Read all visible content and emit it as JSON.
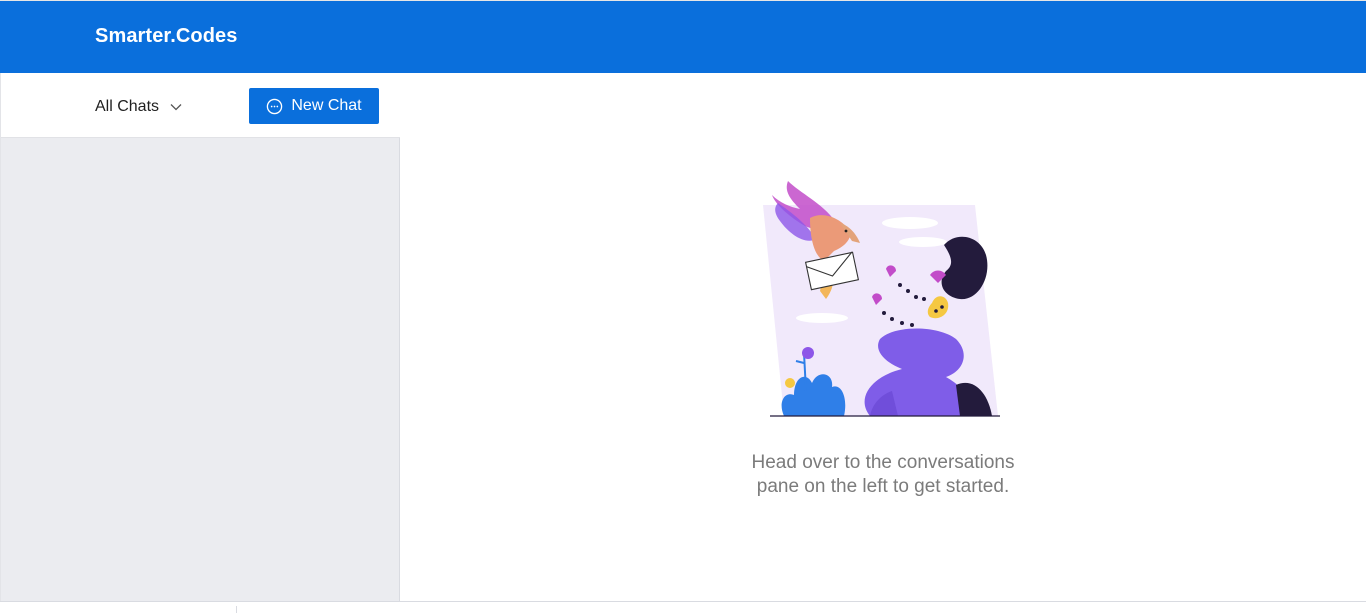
{
  "header": {
    "brand": "Smarter.Codes"
  },
  "sidebar": {
    "filter_label": "All Chats",
    "filter_icon": "chevron-down-icon",
    "new_chat_label": "New Chat",
    "new_chat_icon": "chat-bubble-icon"
  },
  "main": {
    "empty_line1": "Head over to the conversations",
    "empty_line2": "pane on the left to get started."
  },
  "colors": {
    "accent": "#0a6fdc",
    "sidebar_bg": "#ebecf0",
    "muted_text": "#7b7b7b"
  }
}
